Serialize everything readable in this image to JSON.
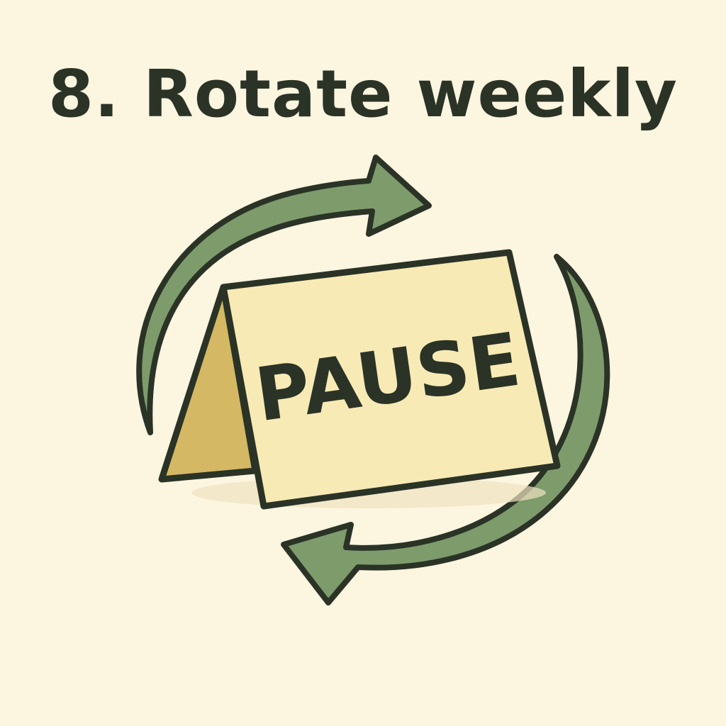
{
  "title": "8. Rotate weekly",
  "sign": {
    "label": "PAUSE"
  },
  "colors": {
    "background": "#fcf5df",
    "outline": "#2a3326",
    "arrow_fill": "#7e9b6c",
    "sign_front": "#f8eab5",
    "sign_side": "#d4b864"
  },
  "icons": {
    "arrows": "circular-rotate-arrows-icon",
    "sign": "tent-card-sign-icon"
  }
}
